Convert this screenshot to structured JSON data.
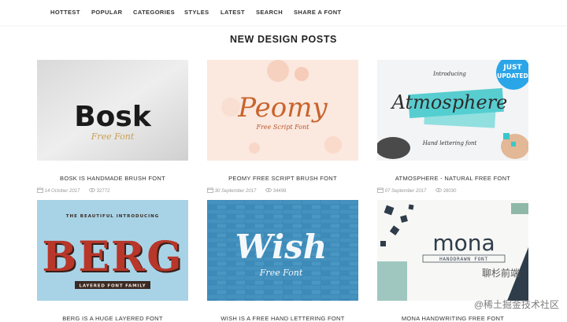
{
  "nav": {
    "items": [
      {
        "label": "HOTTEST"
      },
      {
        "label": "POPULAR"
      },
      {
        "label": "CATEGORIES"
      },
      {
        "label": "STYLES"
      },
      {
        "label": "LATEST"
      },
      {
        "label": "SEARCH"
      },
      {
        "label": "SHARE A FONT"
      }
    ]
  },
  "section": {
    "title": "NEW DESIGN POSTS"
  },
  "posts": [
    {
      "title": "BOSK IS HANDMADE BRUSH FONT",
      "date": "14 October 2017",
      "views": "32772",
      "art_main": "Bosk",
      "art_sub": "Free Font"
    },
    {
      "title": "PEOMY FREE SCRIPT BRUSH FONT",
      "date": "30 September 2017",
      "views": "34498",
      "art_main": "Peomy",
      "art_sub": "Free Script Font"
    },
    {
      "title": "ATMOSPHERE - NATURAL FREE FONT",
      "date": "07 September 2017",
      "views": "28030",
      "art_top": "Introducing",
      "art_main": "Atmosphere",
      "art_sub": "Hand lettering font",
      "badge_1": "JUST",
      "badge_2": "UPDATED"
    },
    {
      "title": "BERG IS A HUGE LAYERED FONT",
      "art_top": "THE BEAUTIFUL INTRODUCING",
      "art_main": "BERG",
      "art_sub": "LAYERED FONT FAMILY"
    },
    {
      "title": "WISH IS A FREE HAND LETTERING FONT",
      "art_main": "Wish",
      "art_sub": "Free Font"
    },
    {
      "title": "MONA HANDWRITING FREE FONT",
      "art_main": "mona",
      "art_sub": "HANDDRAWN FONT"
    }
  ],
  "overlay": {
    "wechat": "聊杉前端",
    "watermark": "@稀土掘金技术社区"
  },
  "colors": {
    "berg_red": "#b8362a",
    "wish_blue": "#3b87b5",
    "atmos_teal": "#3cc6c9",
    "peomy_orange": "#c8642c",
    "badge_blue": "#2aa5e8"
  }
}
